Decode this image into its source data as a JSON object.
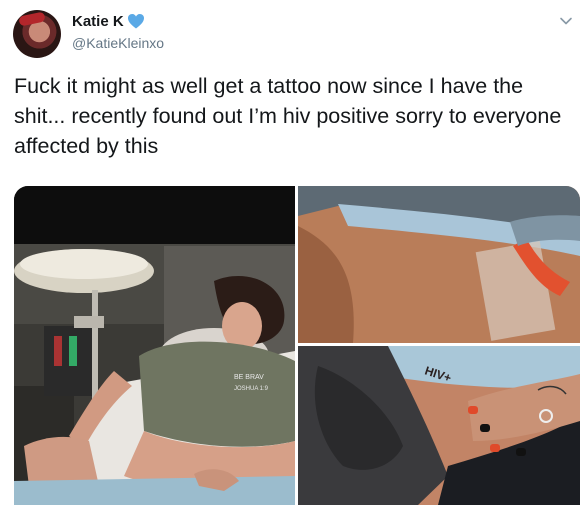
{
  "tweet": {
    "display_name": "Katie K",
    "handle": "@KatieKleinxo",
    "text": "Fuck it might as well get a tattoo now since I have the shit... recently found out I’m hiv positive sorry to everyone affected by this",
    "name_emoji": "blue-heart-icon",
    "menu_icon": "chevron-down-icon"
  },
  "media": {
    "photo_count": 3,
    "photos": [
      {
        "name": "photo-woman-on-tattoo-table",
        "shirt_text": "Joshua 1:9"
      },
      {
        "name": "photo-stencil-application"
      },
      {
        "name": "photo-hiv-tattoo",
        "tattoo_text": "HIV+"
      }
    ]
  },
  "colors": {
    "text": "#14171a",
    "secondary_text": "#657786",
    "heart": "#5aa9e6"
  }
}
